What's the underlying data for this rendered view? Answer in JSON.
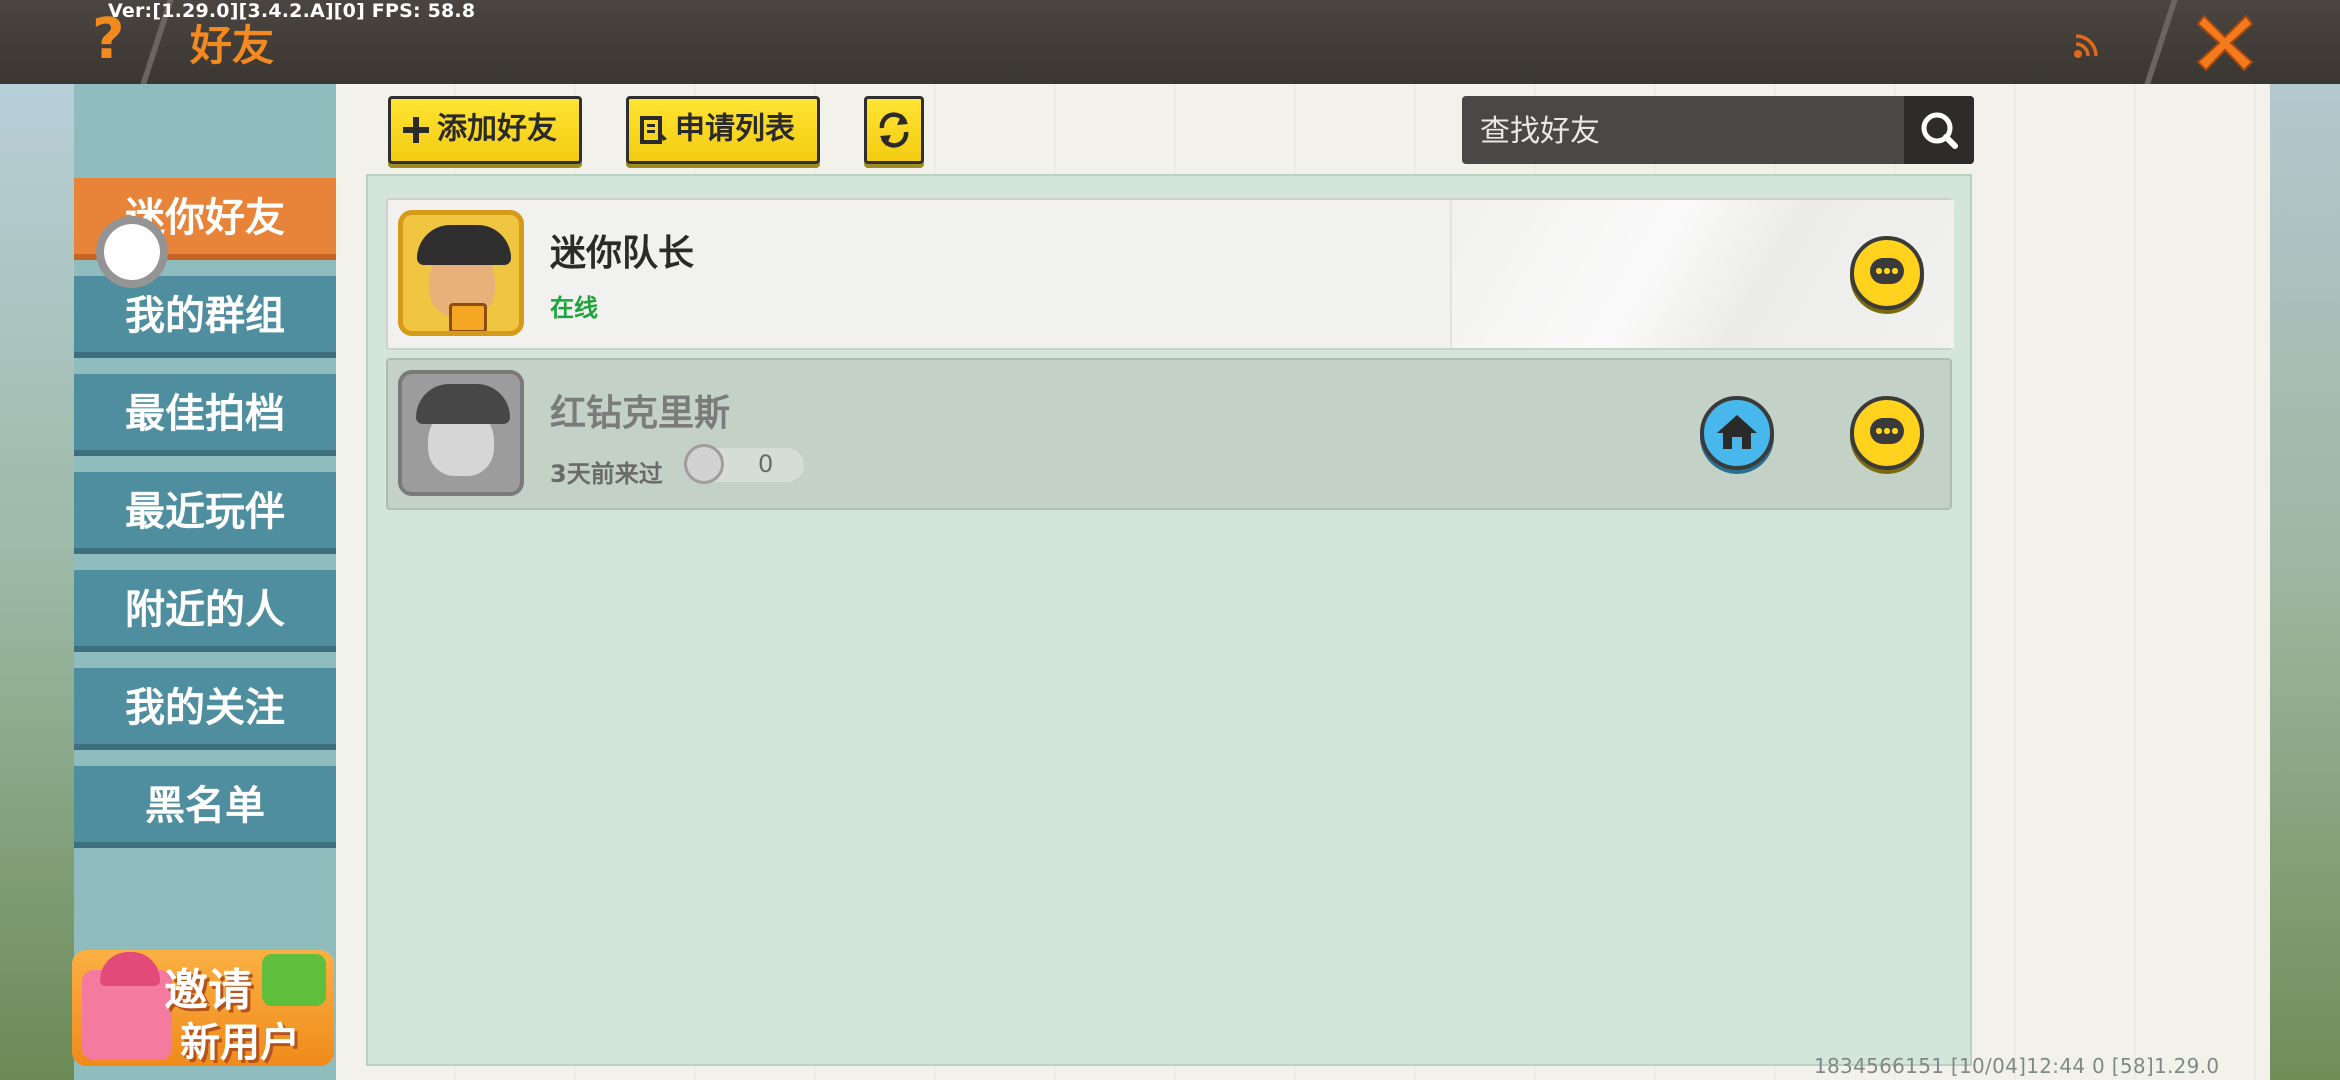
{
  "debug": {
    "version_text": "Ver:[1.29.0][3.4.2.A][0] FPS: 58.8"
  },
  "header": {
    "help_glyph": "?",
    "title": "好友"
  },
  "sidebar": {
    "tabs": [
      {
        "label": "迷你好友",
        "active": true
      },
      {
        "label": "我的群组",
        "active": false
      },
      {
        "label": "最佳拍档",
        "active": false
      },
      {
        "label": "最近玩伴",
        "active": false
      },
      {
        "label": "附近的人",
        "active": false
      },
      {
        "label": "我的关注",
        "active": false
      },
      {
        "label": "黑名单",
        "active": false
      }
    ],
    "invite": {
      "line1": "邀请",
      "line2": "新用户"
    }
  },
  "toolbar": {
    "add_friend_label": "添加好友",
    "request_list_label": "申请列表"
  },
  "search": {
    "placeholder": "查找好友"
  },
  "friends": [
    {
      "name": "迷你队长",
      "status": "在线"
    },
    {
      "name": "红钻克里斯",
      "status": "3天前来过",
      "count": "0"
    }
  ],
  "footer": {
    "text": "1834566151   [10/04]12:44 0  [58]1.29.0"
  },
  "colors": {
    "accent_orange": "#f28a1f",
    "tab_active": "#e8833a",
    "tab_inactive": "#4e8e9e",
    "button_yellow": "#ffe433",
    "online_green": "#1fa33b",
    "home_blue": "#47b7ec"
  }
}
